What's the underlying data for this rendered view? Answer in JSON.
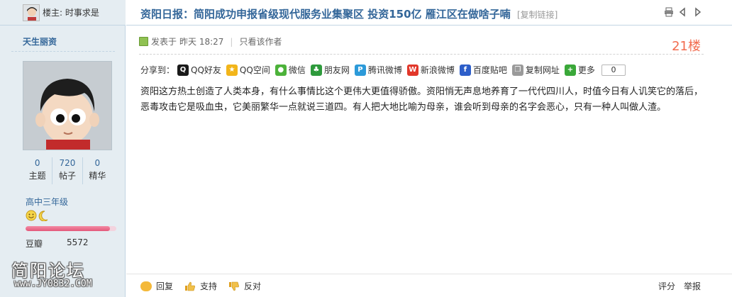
{
  "op": {
    "label": "楼主: 时事求是"
  },
  "author": {
    "name": "天生丽资",
    "stats": [
      {
        "value": "0",
        "label": "主题"
      },
      {
        "value": "720",
        "label": "帖子"
      },
      {
        "value": "0",
        "label": "精华"
      }
    ],
    "level": "高中三年级",
    "credit_fraction": 0.93,
    "bean_label": "豆瓣",
    "bean_value": "5572"
  },
  "watermark": {
    "site": "简阳论坛",
    "url": "www.JY0832.COM"
  },
  "thread": {
    "title": "资阳日报：简阳成功申报省级现代服务业集聚区 投资150亿 雁江区在做啥子喃",
    "copy_link": "[复制链接]"
  },
  "post": {
    "posted_prefix": "发表于",
    "posted_time": "昨天 18:27",
    "author_only": "只看该作者",
    "floor": "21楼",
    "body": "资阳这方热土创造了人类本身，有什么事情比这个更伟大更值得骄傲。资阳悄无声息地养育了一代代四川人，时值今日有人讥笑它的落后，恶毒攻击它是吸血虫，它美丽繁华一点就说三道四。有人把大地比喻为母亲，谁会听到母亲的名字会恶心，只有一种人叫做人渣。"
  },
  "share": {
    "label": "分享到：",
    "items": [
      {
        "label": "QQ好友",
        "icon": "qq-icon",
        "color": "#1a1a1a"
      },
      {
        "label": "QQ空间",
        "icon": "qzone-icon",
        "color": "#f2b51a"
      },
      {
        "label": "微信",
        "icon": "wechat-icon",
        "color": "#4cb23a"
      },
      {
        "label": "朋友网",
        "icon": "pengyou-icon",
        "color": "#2e9a3c"
      },
      {
        "label": "腾讯微博",
        "icon": "tencent-weibo-icon",
        "color": "#2c9ad9"
      },
      {
        "label": "新浪微博",
        "icon": "sina-weibo-icon",
        "color": "#e2372a"
      },
      {
        "label": "百度贴吧",
        "icon": "tieba-icon",
        "color": "#2d5ec9"
      },
      {
        "label": "复制网址",
        "icon": "copy-url-icon",
        "color": "#9a9a9a"
      },
      {
        "label": "更多",
        "icon": "more-icon",
        "color": "#3aa839"
      }
    ],
    "count": "0"
  },
  "actions": {
    "reply": "回复",
    "support": "支持",
    "oppose": "反对",
    "rate": "评分",
    "report": "举报"
  }
}
